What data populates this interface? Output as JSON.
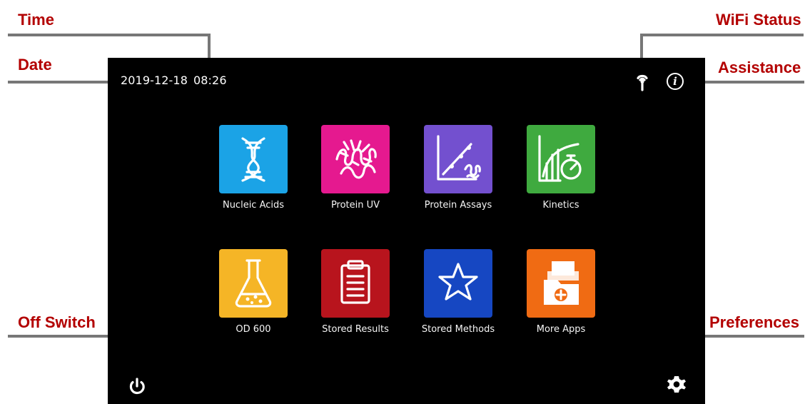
{
  "callouts": {
    "time": "Time",
    "date": "Date",
    "wifi_status": "WiFi Status",
    "assistance": "Assistance",
    "off_switch": "Off Switch",
    "preferences": "Preferences"
  },
  "status_bar": {
    "date": "2019-12-18",
    "time": "08:26",
    "wifi_icon": "wifi-status-icon",
    "assistance_icon": "info-icon"
  },
  "apps": [
    {
      "label": "Nucleic Acids",
      "icon": "dna-icon",
      "color": "#1ba3e6"
    },
    {
      "label": "Protein UV",
      "icon": "protein-structure-icon",
      "color": "#e5198f"
    },
    {
      "label": "Protein Assays",
      "icon": "protein-assay-chart-icon",
      "color": "#7350cf"
    },
    {
      "label": "Kinetics",
      "icon": "kinetics-timer-icon",
      "color": "#3faa3f"
    },
    {
      "label": "OD 600",
      "icon": "flask-icon",
      "color": "#f5b526"
    },
    {
      "label": "Stored Results",
      "icon": "clipboard-icon",
      "color": "#b8141d"
    },
    {
      "label": "Stored Methods",
      "icon": "star-icon",
      "color": "#1647c2"
    },
    {
      "label": "More Apps",
      "icon": "folder-add-icon",
      "color": "#f06b13"
    }
  ],
  "bottom_controls": {
    "power_icon": "power-icon",
    "preferences_icon": "gear-icon"
  },
  "colors": {
    "callout_text": "#b30000",
    "callout_line": "#777777",
    "screen_background": "#000000",
    "screen_text": "#ffffff"
  }
}
